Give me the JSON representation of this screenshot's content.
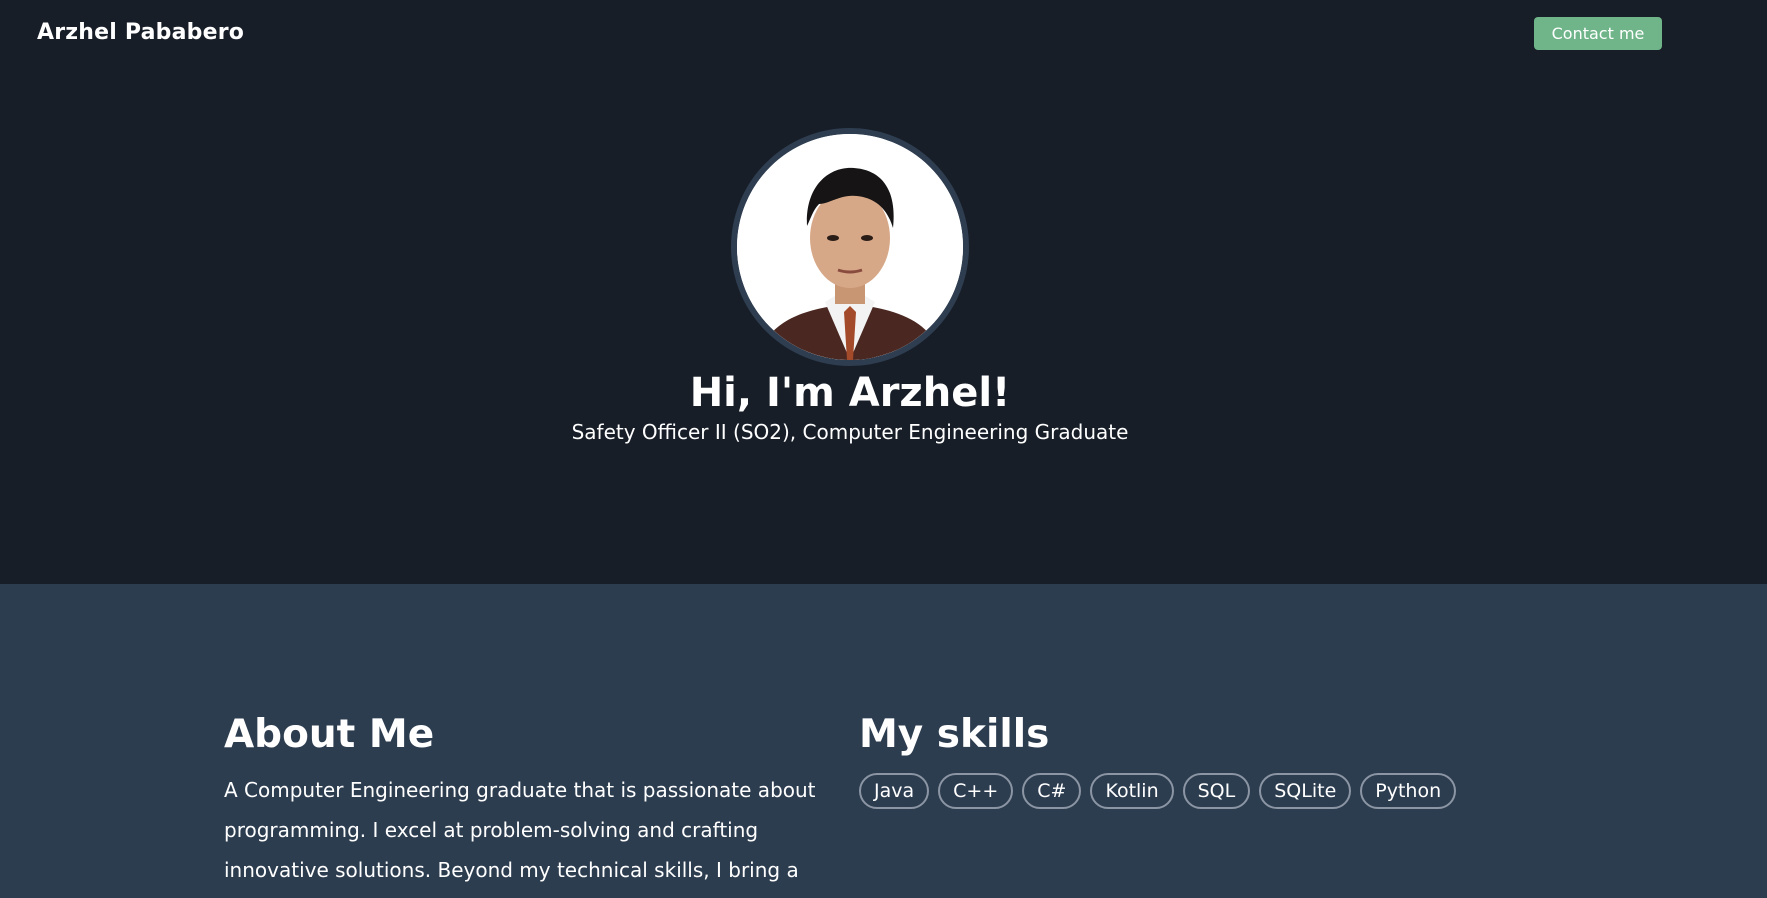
{
  "header": {
    "brand": "Arzhel Pababero",
    "contact_label": "Contact me"
  },
  "hero": {
    "title": "Hi, I'm Arzhel!",
    "subtitle": "Safety Officer II (SO2), Computer Engineering Graduate"
  },
  "about": {
    "heading": "About Me",
    "text": "A Computer Engineering graduate that is passionate about programming. I excel at problem-solving and crafting innovative solutions. Beyond my technical skills, I bring a"
  },
  "skills": {
    "heading": "My skills",
    "items": [
      "Java",
      "C++",
      "C#",
      "Kotlin",
      "SQL",
      "SQLite",
      "Python"
    ]
  },
  "colors": {
    "hero_bg": "#171e28",
    "section_bg": "#2d3d50",
    "accent": "#6fb589"
  }
}
